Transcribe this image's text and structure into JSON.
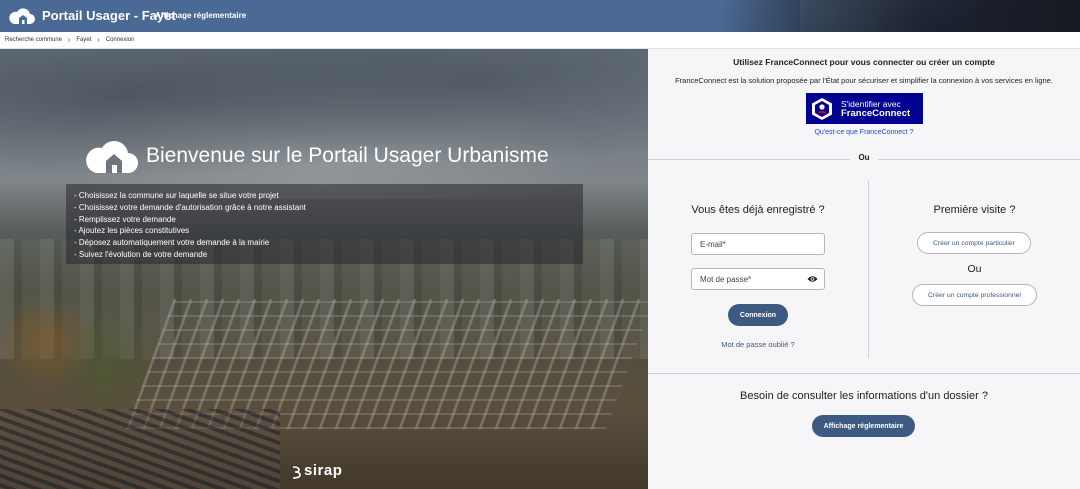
{
  "header": {
    "title": "Portail Usager - Fayet",
    "link": "Affichage réglementaire",
    "logo_icon": "cloud-house-icon"
  },
  "breadcrumb": {
    "items": [
      "Recherche commune",
      "Fayet",
      "Connexion"
    ],
    "separator_icon": "chevron-right-icon"
  },
  "hero": {
    "title": "Bienvenue sur le Portail Usager Urbanisme",
    "steps": [
      "- Choisissez la commune sur laquelle se situe votre projet",
      "- Choisissez votre demande d'autorisation grâce à notre assistant",
      "- Remplissez votre demande",
      "- Ajoutez les pièces constitutives",
      "- Déposez automatiquement votre demande à la mairie",
      "- Suivez l'évolution de votre demande"
    ],
    "brand": "sirap"
  },
  "franceconnect": {
    "title": "Utilisez FranceConnect pour vous connecter ou créer un compte",
    "description": "FranceConnect est la solution proposée par l'État pour sécuriser et simplifier la connexion à vos services en ligne.",
    "button_line1": "S'identifier avec",
    "button_line2": "FranceConnect",
    "help_link": "Qu'est-ce que FranceConnect ?",
    "brand_color": "#000091"
  },
  "divider_label": "Ou",
  "login": {
    "title": "Vous êtes déjà enregistré ?",
    "email_placeholder": "E-mail*",
    "password_placeholder": "Mot de passe*",
    "submit_label": "Connexion",
    "forgot_link": "Mot de passe oublié ?"
  },
  "first_visit": {
    "title": "Première visite ?",
    "particulier_label": "Créer un compte particulier",
    "or_label": "Ou",
    "professionnel_label": "Créer un compte professionnel"
  },
  "dossier": {
    "title": "Besoin de consulter les informations d'un dossier ?",
    "button_label": "Affichage réglementaire"
  },
  "colors": {
    "header": "#4a6a95",
    "primary_button": "#3d5a83",
    "link": "#1a4dcc"
  }
}
